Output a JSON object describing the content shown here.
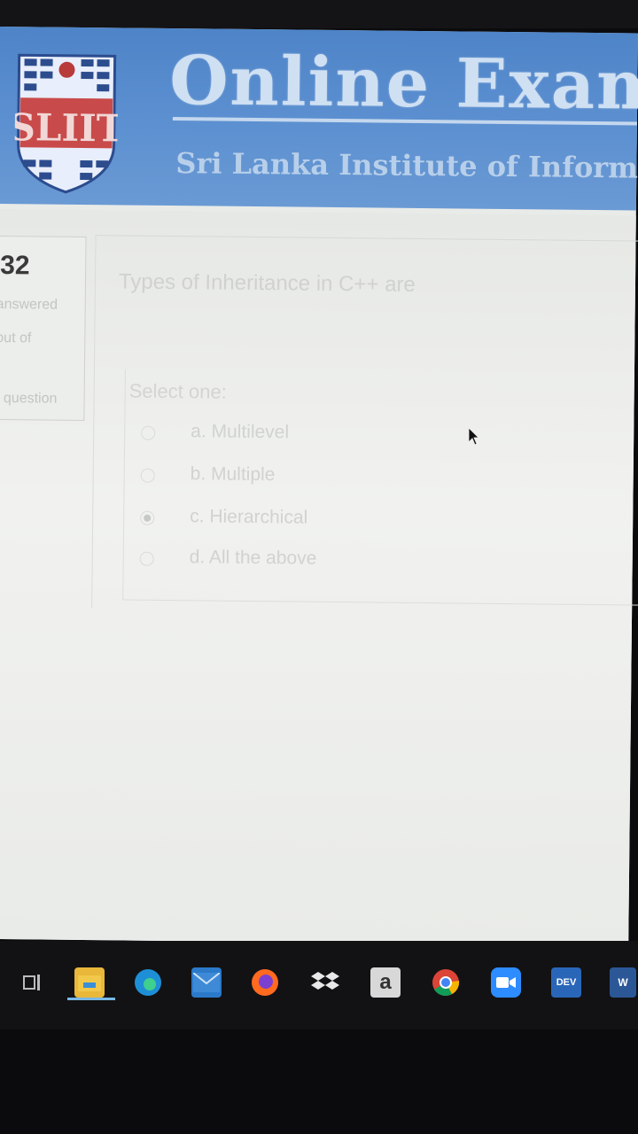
{
  "header": {
    "title": "Online Exam",
    "subtitle": "Sri Lanka Institute of Informati",
    "logo_text": "SLIIT"
  },
  "quiz_info": {
    "question_number": "32",
    "status_line1": "answered",
    "status_line2": "out of",
    "flag_label": "g question"
  },
  "question": {
    "text": "Types of Inheritance in C++ are",
    "select_prompt": "Select one:",
    "options": [
      {
        "label": "a. Multilevel",
        "selected": false
      },
      {
        "label": "b. Multiple",
        "selected": false
      },
      {
        "label": "c. Hierarchical",
        "selected": true
      },
      {
        "label": "d. All the above",
        "selected": false
      }
    ]
  },
  "taskbar": {
    "icons": [
      "task-view-icon",
      "file-explorer-icon",
      "edge-icon",
      "mail-icon",
      "firefox-icon",
      "dropbox-icon",
      "amazon-icon",
      "chrome-icon",
      "zoom-icon",
      "dev-icon",
      "word-icon"
    ],
    "amazon_letter": "a",
    "dev_label": "DEV",
    "word_label": "W"
  },
  "colors": {
    "header_blue": "#5b8fd0",
    "screen_bg": "#e9ebe8",
    "taskbar_bg": "#121214"
  }
}
